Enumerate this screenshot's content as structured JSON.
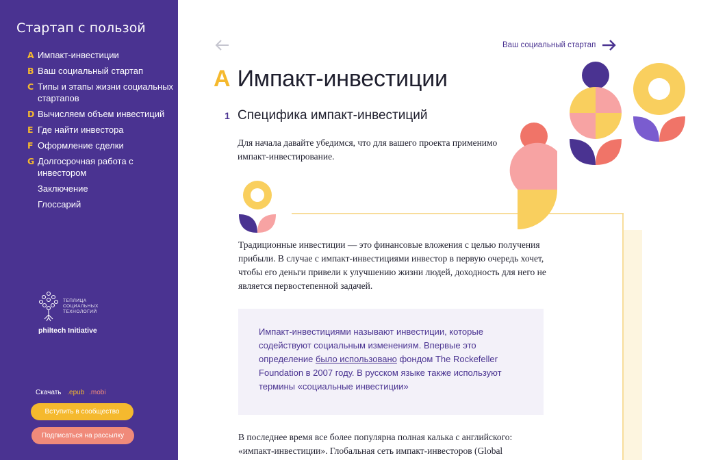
{
  "sidebar": {
    "brand": "Стартап с пользой",
    "toc": [
      {
        "letter": "A",
        "label": "Импакт-инвестиции"
      },
      {
        "letter": "B",
        "label": "Ваш социальный стартап"
      },
      {
        "letter": "C",
        "label": "Типы и этапы жизни социальных стартапов"
      },
      {
        "letter": "D",
        "label": "Вычисляем объем инвестиций"
      },
      {
        "letter": "E",
        "label": "Где найти инвестора"
      },
      {
        "letter": "F",
        "label": "Оформление сделки"
      },
      {
        "letter": "G",
        "label": "Долгосрочная работа с инвестором"
      },
      {
        "letter": "",
        "label": "Заключение"
      },
      {
        "letter": "",
        "label": "Глоссарий"
      }
    ],
    "org_text": "ТЕПЛИЦА СОЦИАЛЬНЫХ ТЕХНОЛОГИЙ",
    "org_name": "philtech Initiative",
    "download_label": "Скачать",
    "download_epub": ".epub",
    "download_mobi": ".mobi",
    "join_button": "Вступить в сообщество",
    "subscribe_button": "Подписаться на рассылку"
  },
  "nav": {
    "next_label": "Ваш социальный стартап"
  },
  "chapter": {
    "letter": "A",
    "title": "Импакт-инвестиции"
  },
  "section": {
    "number": "1",
    "title": "Специфика импакт-инвестиций"
  },
  "content": {
    "intro": "Для начала давайте убедимся, что для вашего проекта применимо импакт-инвестирование.",
    "paragraph1": "Традиционные инвестиции — это финансовые вложения с целью получения прибыли. В случае с импакт-инвестициями инвестор в первую очередь хочет, чтобы его деньги привели к улучшению жизни людей, доходность для него не является первостепенной задачей.",
    "quote_before": "Импакт-инвестициями называют инвестиции, которые содействуют социальным изменениям. Впервые это определение ",
    "quote_link": "было использовано",
    "quote_after": " фондом The Rockefeller Foundation в 2007 году. В русском языке также используют термины «социальные инвестиции»",
    "paragraph2": "В последнее время все более популярна полная калька с английского: «импакт-инвестиции». Глобальная сеть импакт-инвесторов (Global"
  },
  "colors": {
    "sidebar_bg": "#4a3391",
    "accent_yellow": "#f5b92e",
    "accent_coral": "#f08a7a",
    "accent_pink": "#f7a3a3",
    "quote_bg": "#f3f1f9"
  }
}
